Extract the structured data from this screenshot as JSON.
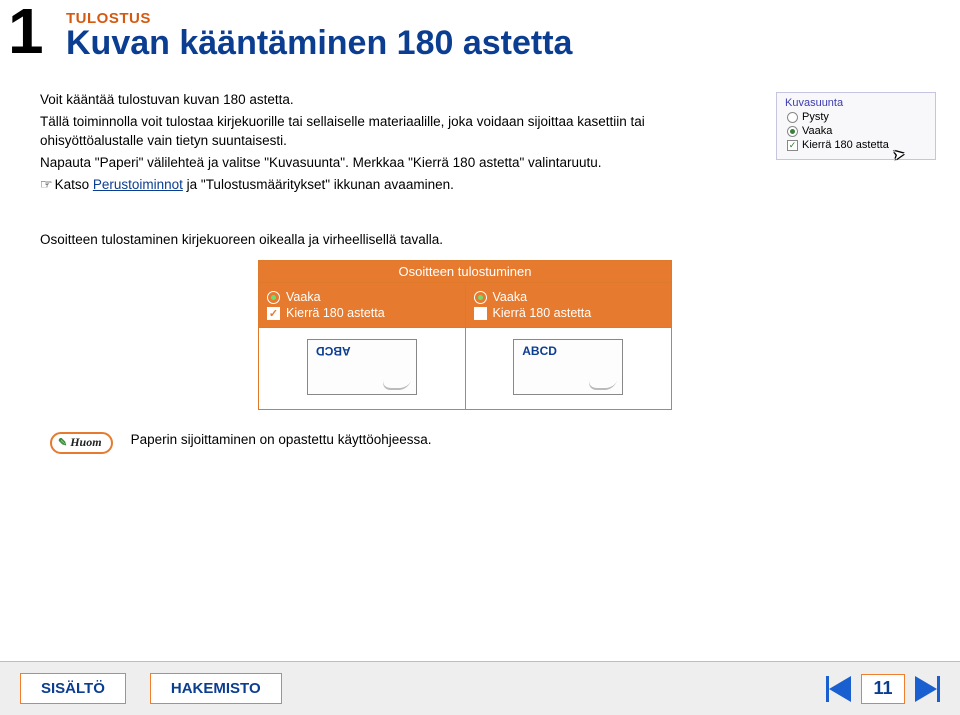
{
  "header": {
    "step_number": "1",
    "section_label": "TULOSTUS",
    "title": "Kuvan kääntäminen 180 astetta"
  },
  "intro": {
    "line1": "Voit kääntää tulostuvan kuvan 180 astetta.",
    "line2": "Tällä toiminnolla voit tulostaa kirjekuorille tai sellaiselle materiaalille, joka voidaan sijoittaa kasettiin tai ohisyöttöalustalle vain tietyn suuntaisesti.",
    "line3": "Napauta \"Paperi\" välilehteä ja valitse \"Kuvasuunta\". Merkkaa \"Kierrä 180 astetta\" valintaruutu.",
    "line4_pre": "Katso ",
    "line4_link": "Perustoiminnot",
    "line4_post": " ja \"Tulostusmääritykset\" ikkunan avaaminen."
  },
  "panel": {
    "group": "Kuvasuunta",
    "opt_portrait": "Pysty",
    "opt_landscape": "Vaaka",
    "check_rotate": "Kierrä 180 astetta"
  },
  "caption": "Osoitteen tulostaminen kirjekuoreen oikealla ja virheellisellä tavalla.",
  "table": {
    "title": "Osoitteen tulostuminen",
    "col1": {
      "radio": "Vaaka",
      "check": "Kierrä 180 astetta",
      "sample": "ABCD"
    },
    "col2": {
      "radio": "Vaaka",
      "check": "Kierrä 180 astetta",
      "sample": "ABCD"
    }
  },
  "note": {
    "tag": "Huom",
    "text": "Paperin sijoittaminen on opastettu käyttöohjeessa."
  },
  "footer": {
    "btn_contents": "SISÄLTÖ",
    "btn_index": "HAKEMISTO",
    "page_number": "11"
  }
}
